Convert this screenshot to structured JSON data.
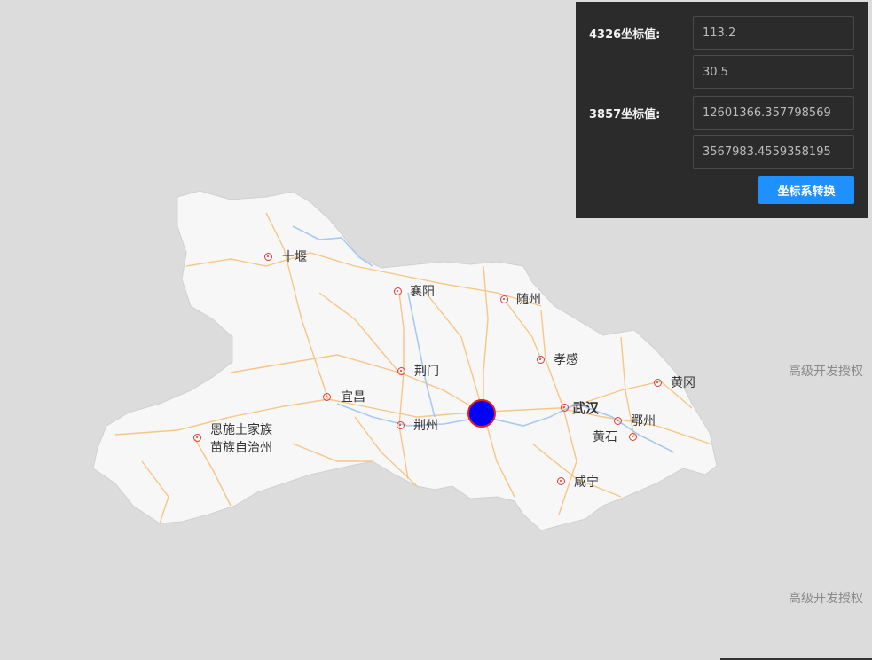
{
  "map": {
    "cities": [
      {
        "id": "shiyan",
        "name": "十堰"
      },
      {
        "id": "xiangyang",
        "name": "襄阳"
      },
      {
        "id": "suizhou",
        "name": "随州"
      },
      {
        "id": "xiaogan",
        "name": "孝感"
      },
      {
        "id": "jingmen",
        "name": "荆门"
      },
      {
        "id": "huanggang",
        "name": "黄冈"
      },
      {
        "id": "yichang",
        "name": "宜昌"
      },
      {
        "id": "wuhan",
        "name": "武汉"
      },
      {
        "id": "ezhou",
        "name": "鄂州"
      },
      {
        "id": "enshi_line1",
        "name": "恩施土家族"
      },
      {
        "id": "enshi_line2",
        "name": "苗族自治州"
      },
      {
        "id": "jingzhou",
        "name": "荆州"
      },
      {
        "id": "huangshi",
        "name": "黄石"
      },
      {
        "id": "xianning",
        "name": "咸宁"
      }
    ],
    "point_marker": {
      "lon": 113.2,
      "lat": 30.5,
      "fill": "#0000ff",
      "stroke": "#e02020"
    },
    "land_color": "#f7f7f7",
    "road_color": "#f7c07a",
    "water_color": "#a9c9f0"
  },
  "watermarks": [
    "高级开发授权",
    "高级开发授权"
  ],
  "panel": {
    "label_4326": "4326坐标值:",
    "lon_4326": "113.2",
    "lat_4326": "30.5",
    "label_3857": "3857坐标值:",
    "x_3857": "12601366.357798569",
    "y_3857": "3567983.4559358195",
    "convert_button": "坐标系转换",
    "accent": "#1e90ff"
  }
}
